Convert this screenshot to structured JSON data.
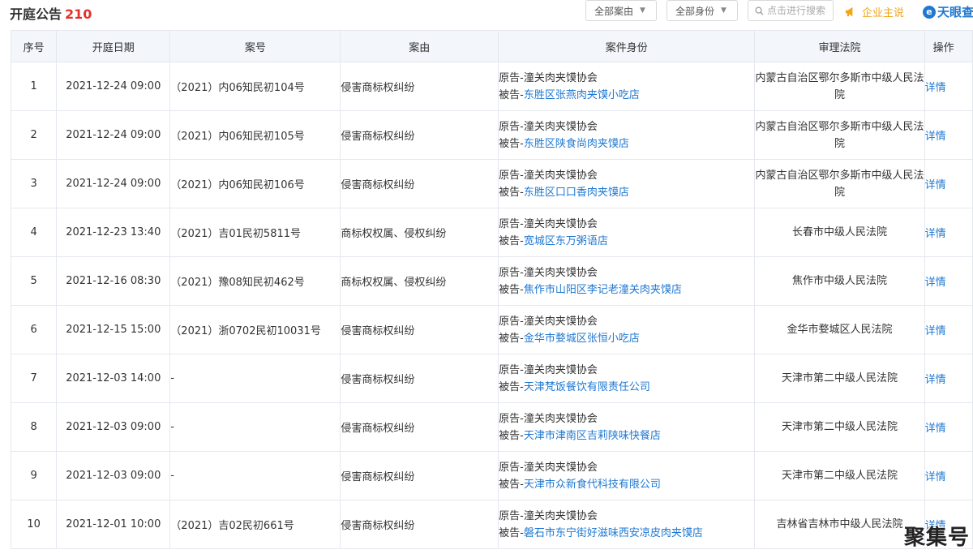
{
  "header": {
    "title": "开庭公告",
    "count": "210",
    "filter_case": "全部案由",
    "filter_identity": "全部身份",
    "search_placeholder": "点击进行搜索",
    "promo_label": "企业主说",
    "brand": "天眼查"
  },
  "columns": [
    "序号",
    "开庭日期",
    "案号",
    "案由",
    "案件身份",
    "审理法院",
    "操作"
  ],
  "rows": [
    {
      "no": "1",
      "date": "2021-12-24 09:00",
      "case_no": "（2021）内06知民初104号",
      "reason": "侵害商标权纠纷",
      "plaintiff_label": "原告-",
      "plaintiff": "潼关肉夹馍协会",
      "defendant_label": "被告-",
      "defendant": "东胜区张燕肉夹馍小吃店",
      "court": "内蒙古自治区鄂尔多斯市中级人民法院",
      "action": "详情"
    },
    {
      "no": "2",
      "date": "2021-12-24 09:00",
      "case_no": "（2021）内06知民初105号",
      "reason": "侵害商标权纠纷",
      "plaintiff_label": "原告-",
      "plaintiff": "潼关肉夹馍协会",
      "defendant_label": "被告-",
      "defendant": "东胜区陕食尚肉夹馍店",
      "court": "内蒙古自治区鄂尔多斯市中级人民法院",
      "action": "详情"
    },
    {
      "no": "3",
      "date": "2021-12-24 09:00",
      "case_no": "（2021）内06知民初106号",
      "reason": "侵害商标权纠纷",
      "plaintiff_label": "原告-",
      "plaintiff": "潼关肉夹馍协会",
      "defendant_label": "被告-",
      "defendant": "东胜区口口香肉夹馍店",
      "court": "内蒙古自治区鄂尔多斯市中级人民法院",
      "action": "详情"
    },
    {
      "no": "4",
      "date": "2021-12-23 13:40",
      "case_no": "（2021）吉01民初5811号",
      "reason": "商标权权属、侵权纠纷",
      "plaintiff_label": "原告-",
      "plaintiff": "潼关肉夹馍协会",
      "defendant_label": "被告-",
      "defendant": "宽城区东万粥语店",
      "court": "长春市中级人民法院",
      "action": "详情"
    },
    {
      "no": "5",
      "date": "2021-12-16 08:30",
      "case_no": "（2021）豫08知民初462号",
      "reason": "商标权权属、侵权纠纷",
      "plaintiff_label": "原告-",
      "plaintiff": "潼关肉夹馍协会",
      "defendant_label": "被告-",
      "defendant": "焦作市山阳区李记老潼关肉夹馍店",
      "court": "焦作市中级人民法院",
      "action": "详情"
    },
    {
      "no": "6",
      "date": "2021-12-15 15:00",
      "case_no": "（2021）浙0702民初10031号",
      "reason": "侵害商标权纠纷",
      "plaintiff_label": "原告-",
      "plaintiff": "潼关肉夹馍协会",
      "defendant_label": "被告-",
      "defendant": "金华市婺城区张恒小吃店",
      "court": "金华市婺城区人民法院",
      "action": "详情"
    },
    {
      "no": "7",
      "date": "2021-12-03 14:00",
      "case_no": "-",
      "reason": "侵害商标权纠纷",
      "plaintiff_label": "原告-",
      "plaintiff": "潼关肉夹馍协会",
      "defendant_label": "被告-",
      "defendant": "天津梵饭餐饮有限责任公司",
      "court": "天津市第二中级人民法院",
      "action": "详情"
    },
    {
      "no": "8",
      "date": "2021-12-03 09:00",
      "case_no": "-",
      "reason": "侵害商标权纠纷",
      "plaintiff_label": "原告-",
      "plaintiff": "潼关肉夹馍协会",
      "defendant_label": "被告-",
      "defendant": "天津市津南区吉莉陕味快餐店",
      "court": "天津市第二中级人民法院",
      "action": "详情"
    },
    {
      "no": "9",
      "date": "2021-12-03 09:00",
      "case_no": "-",
      "reason": "侵害商标权纠纷",
      "plaintiff_label": "原告-",
      "plaintiff": "潼关肉夹馍协会",
      "defendant_label": "被告-",
      "defendant": "天津市众新食代科技有限公司",
      "court": "天津市第二中级人民法院",
      "action": "详情"
    },
    {
      "no": "10",
      "date": "2021-12-01 10:00",
      "case_no": "（2021）吉02民初661号",
      "reason": "侵害商标权纠纷",
      "plaintiff_label": "原告-",
      "plaintiff": "潼关肉夹馍协会",
      "defendant_label": "被告-",
      "defendant": "磐石市东宁街好滋味西安凉皮肉夹馍店",
      "court": "吉林省吉林市中级人民法院",
      "action": "详情"
    }
  ],
  "watermark": "聚集号"
}
